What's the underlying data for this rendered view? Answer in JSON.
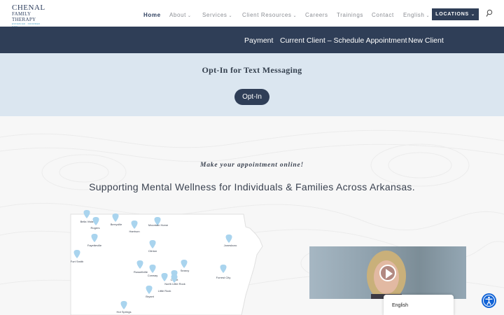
{
  "logo": {
    "line1": "CHENAL",
    "line2": "FAMILY THERAPY",
    "line3": "EVIDENCED · INFORMED · SAFE"
  },
  "nav": {
    "items": [
      {
        "label": "Home",
        "dropdown": false,
        "active": true
      },
      {
        "label": "About",
        "dropdown": true,
        "active": false
      },
      {
        "label": "Services",
        "dropdown": true,
        "active": false
      },
      {
        "label": "Client Resources",
        "dropdown": true,
        "active": false
      },
      {
        "label": "Careers",
        "dropdown": false,
        "active": false
      },
      {
        "label": "Trainings",
        "dropdown": false,
        "active": false
      },
      {
        "label": "Contact",
        "dropdown": false,
        "active": false
      },
      {
        "label": "English",
        "dropdown": true,
        "active": false
      }
    ],
    "locations_label": "LOCATIONS",
    "search_icon": "search-icon"
  },
  "subbar": {
    "links": [
      "Payment",
      "Current Client – Schedule Appointment",
      "New Client"
    ]
  },
  "optin": {
    "title": "Opt-In for Text Messaging",
    "button_label": "Opt-In"
  },
  "main": {
    "tagline": "Make your appointment online!",
    "headline": "Supporting Mental Wellness for Individuals & Families Across Arkansas."
  },
  "map": {
    "locations": [
      "Bella Vista",
      "Rogers",
      "Berryville",
      "Harrison",
      "Mountain Home",
      "Fayetteville",
      "Clinton",
      "Jonesboro",
      "Fort Smith",
      "Russellville",
      "Conway",
      "Searcy",
      "Cabot",
      "North Little Rock",
      "Forrest City",
      "Little Rock",
      "Bryant",
      "Hot Springs"
    ]
  },
  "video": {
    "play_icon": "play-icon"
  },
  "language_widget": {
    "label": "English"
  },
  "accessibility": {
    "icon": "accessibility-icon"
  },
  "colors": {
    "navy": "#2f3e57",
    "light_blue": "#dbe6f0",
    "pin": "#a9d4ee",
    "accessibility": "#1163d6"
  }
}
